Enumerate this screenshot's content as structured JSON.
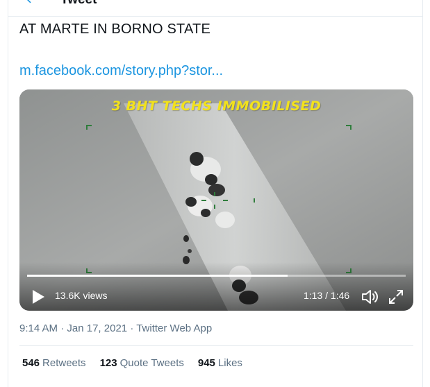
{
  "header": {
    "title": "Tweet",
    "back_icon": "back-arrow-icon"
  },
  "tweet": {
    "text": "AT MARTE IN BORNO STATE",
    "link": "m.facebook.com/story.php?stor..."
  },
  "media": {
    "overlay_caption": "3 BHT TECHS IMMOBILISED",
    "views": "13.6K views",
    "time": "1:13 / 1:46",
    "progress": 0.688,
    "icons": [
      "play-icon",
      "volume-icon",
      "fullscreen-icon"
    ]
  },
  "meta": {
    "time": "9:14 AM",
    "date": "Jan 17, 2021",
    "source": "Twitter Web App",
    "separator": "·"
  },
  "stats": {
    "retweets_count": "546",
    "retweets_label": "Retweets",
    "quotes_count": "123",
    "quotes_label": "Quote Tweets",
    "likes_count": "945",
    "likes_label": "Likes"
  },
  "colors": {
    "link": "#1b95e0",
    "caption": "#f2e21c",
    "secondary_text": "#5b7083",
    "border": "#e6ecf0"
  }
}
